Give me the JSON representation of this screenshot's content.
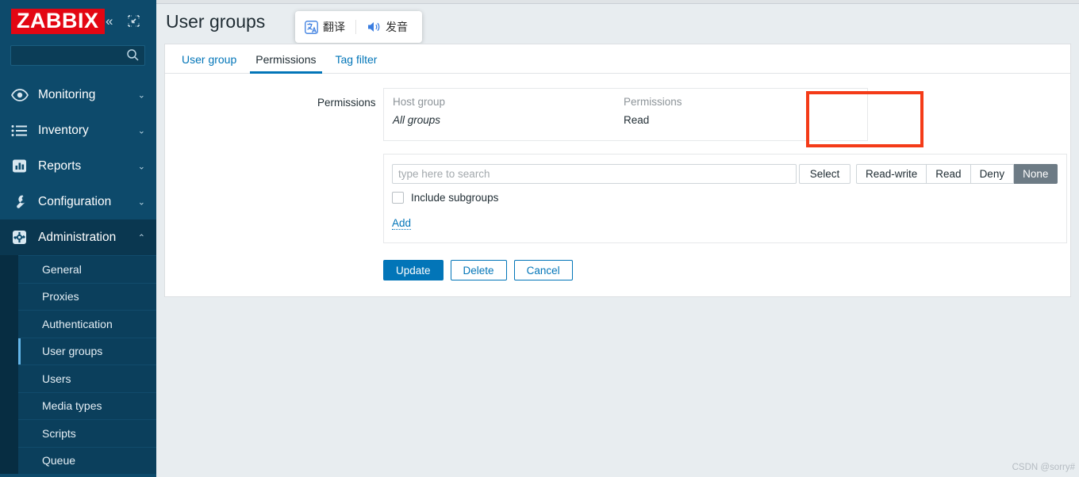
{
  "sidebar": {
    "logo": "ZABBIX",
    "collapse_icon": "double-chevron-left-icon",
    "compact_icon": "compact-view-icon",
    "search_placeholder": "",
    "menu": [
      {
        "label": "Monitoring",
        "icon": "eye-icon",
        "chevron": "⌄",
        "active": false
      },
      {
        "label": "Inventory",
        "icon": "list-icon",
        "chevron": "⌄",
        "active": false
      },
      {
        "label": "Reports",
        "icon": "chart-icon",
        "chevron": "⌄",
        "active": false
      },
      {
        "label": "Configuration",
        "icon": "wrench-icon",
        "chevron": "⌄",
        "active": false
      },
      {
        "label": "Administration",
        "icon": "gear-icon",
        "chevron": "⌃",
        "active": true
      }
    ],
    "submenu": [
      {
        "label": "General",
        "active": false
      },
      {
        "label": "Proxies",
        "active": false
      },
      {
        "label": "Authentication",
        "active": false
      },
      {
        "label": "User groups",
        "active": true
      },
      {
        "label": "Users",
        "active": false
      },
      {
        "label": "Media types",
        "active": false
      },
      {
        "label": "Scripts",
        "active": false
      },
      {
        "label": "Queue",
        "active": false
      }
    ]
  },
  "header": {
    "title": "User groups"
  },
  "translate_popup": {
    "translate_label": "翻译",
    "speak_label": "发音",
    "translate_icon": "translate-icon",
    "speak_icon": "speaker-icon"
  },
  "tabs": [
    {
      "label": "User group",
      "active": false
    },
    {
      "label": "Permissions",
      "active": true
    },
    {
      "label": "Tag filter",
      "active": false
    }
  ],
  "form": {
    "field_label": "Permissions",
    "permissions_table": {
      "headers": [
        "Host group",
        "Permissions"
      ],
      "rows": [
        {
          "host_group": "All groups",
          "permission": "Read"
        }
      ]
    },
    "search": {
      "value": "",
      "placeholder": "type here to search"
    },
    "select_button": "Select",
    "level_buttons": [
      {
        "label": "Read-write",
        "active": false
      },
      {
        "label": "Read",
        "active": false
      },
      {
        "label": "Deny",
        "active": false
      },
      {
        "label": "None",
        "active": true
      }
    ],
    "include_subgroups_label": "Include subgroups",
    "include_subgroups_checked": false,
    "add_link": "Add"
  },
  "actions": {
    "update": "Update",
    "delete": "Delete",
    "cancel": "Cancel"
  },
  "watermark": "CSDN @sorry#",
  "colors": {
    "sidebar_bg": "#0d4a6b",
    "logo_red": "#e30613",
    "accent_blue": "#0275b8",
    "highlight_red": "#f43b18",
    "active_segment": "#6d7b85",
    "page_bg": "#e8edf0"
  }
}
